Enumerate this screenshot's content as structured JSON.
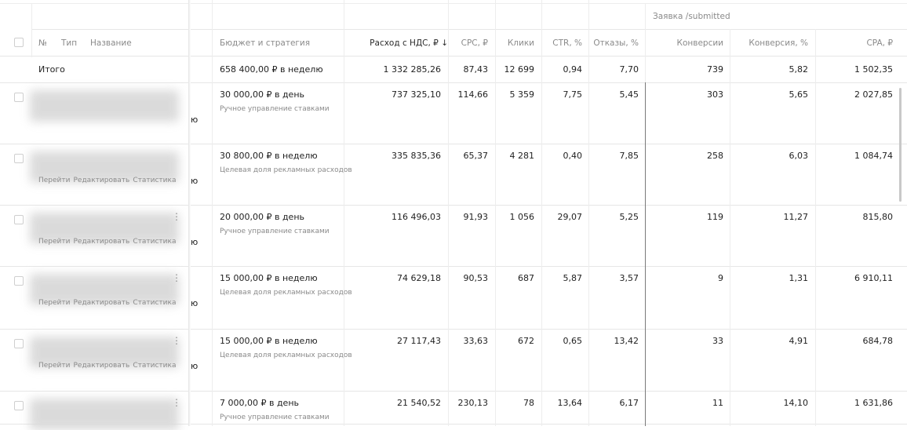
{
  "group_header": "Заявка /submitted",
  "headers": {
    "number": "№",
    "type": "Тип",
    "name": "Название",
    "budget": "Бюджет и стратегия",
    "spend": "Расход с НДС, ₽",
    "spend_sort": "↓",
    "cpc": "CPC, ₽",
    "clicks": "Клики",
    "ctr": "CTR, %",
    "bounces": "Отказы, %",
    "conversions": "Конверсии",
    "conversion_rate": "Конверсия, %",
    "cpa": "CPA, ₽"
  },
  "total": {
    "label": "Итого",
    "budget": "658 400,00 ₽ в неделю",
    "spend": "1 332 285,26",
    "cpc": "87,43",
    "clicks": "12 699",
    "ctr": "0,94",
    "bounces": "7,70",
    "conversions": "739",
    "conversion_rate": "5,82",
    "cpa": "1 502,35"
  },
  "rows": [
    {
      "name_tail": "ю",
      "budget": "30 000,00 ₽ в день",
      "strategy": "Ручное управление ставками",
      "spend": "737 325,10",
      "cpc": "114,66",
      "clicks": "5 359",
      "ctr": "7,75",
      "bounces": "5,45",
      "conversions": "303",
      "conversion_rate": "5,65",
      "cpa": "2 027,85",
      "actions": [],
      "menu": ""
    },
    {
      "name_tail": "ю",
      "budget": "30 800,00 ₽ в неделю",
      "strategy": "Целевая доля рекламных расходов",
      "spend": "335 835,36",
      "cpc": "65,37",
      "clicks": "4 281",
      "ctr": "0,40",
      "bounces": "7,85",
      "conversions": "258",
      "conversion_rate": "6,03",
      "cpa": "1 084,74",
      "actions": [
        "Перейти",
        "Редактировать",
        "Статистика"
      ],
      "menu": ""
    },
    {
      "name_tail": "ю",
      "budget": "20 000,00 ₽ в день",
      "strategy": "Ручное управление ставками",
      "spend": "116 496,03",
      "cpc": "91,93",
      "clicks": "1 056",
      "ctr": "29,07",
      "bounces": "5,25",
      "conversions": "119",
      "conversion_rate": "11,27",
      "cpa": "815,80",
      "actions": [
        "Перейти",
        "Редактировать",
        "Статистика"
      ],
      "menu": "⋮"
    },
    {
      "name_tail": "ю",
      "budget": "15 000,00 ₽ в неделю",
      "strategy": "Целевая доля рекламных расходов",
      "spend": "74 629,18",
      "cpc": "90,53",
      "clicks": "687",
      "ctr": "5,87",
      "bounces": "3,57",
      "conversions": "9",
      "conversion_rate": "1,31",
      "cpa": "6 910,11",
      "actions": [
        "Перейти",
        "Редактировать",
        "Статистика"
      ],
      "menu": "⋮"
    },
    {
      "name_tail": "ю",
      "budget": "15 000,00 ₽ в неделю",
      "strategy": "Целевая доля рекламных расходов",
      "spend": "27 117,43",
      "cpc": "33,63",
      "clicks": "672",
      "ctr": "0,65",
      "bounces": "13,42",
      "conversions": "33",
      "conversion_rate": "4,91",
      "cpa": "684,78",
      "actions": [
        "Перейти",
        "Редактировать",
        "Статистика"
      ],
      "menu": "⋮"
    },
    {
      "name_tail": "",
      "budget": "7 000,00 ₽ в день",
      "strategy": "Ручное управление ставками",
      "spend": "21 540,52",
      "cpc": "230,13",
      "clicks": "78",
      "ctr": "13,64",
      "bounces": "6,17",
      "conversions": "11",
      "conversion_rate": "14,10",
      "cpa": "1 631,86",
      "actions": [],
      "menu": "⋮"
    }
  ]
}
